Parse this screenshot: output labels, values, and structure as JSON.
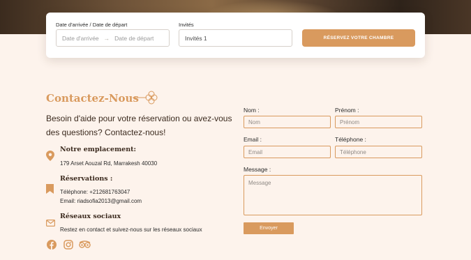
{
  "booking": {
    "dates_label": "Date d'arrivée / Date de départ",
    "arrival_placeholder": "Date d'arrivée",
    "departure_placeholder": "Date de départ",
    "guests_label": "Invités",
    "guests_value": "Invités 1",
    "reserve_button": "RÉSERVEZ VOTRE CHAMBRE"
  },
  "contact": {
    "title": "Contactez-Nous",
    "intro": "Besoin d'aide pour votre réservation ou avez-vous des questions? Contactez-nous!",
    "location": {
      "title": "Notre emplacement:",
      "address": "179 Arset Aouzal Rd, Marrakesh 40030"
    },
    "reservations": {
      "title": "Réservations :",
      "phone": "Téléphone: +212681763047",
      "email": "Email: riadsofia2013@gmail.com"
    },
    "social": {
      "title": "Réseaux sociaux",
      "text": "Restez en contact et suivez-nous sur les réseaux sociaux"
    }
  },
  "form": {
    "nom_label": "Nom :",
    "nom_placeholder": "Nom",
    "prenom_label": "Prénom :",
    "prenom_placeholder": "Prénom",
    "email_label": "Email :",
    "email_placeholder": "Email",
    "phone_label": "Téléphone :",
    "phone_placeholder": "Téléphone",
    "message_label": "Message :",
    "message_placeholder": "Message",
    "submit": "Envoyer"
  },
  "colors": {
    "accent": "#d99a5e",
    "background": "#fdf3ec",
    "text": "#3b2a1e"
  },
  "icons": [
    "map-pin-icon",
    "bookmark-icon",
    "mail-icon",
    "facebook-icon",
    "instagram-icon",
    "tripadvisor-icon",
    "ornament-icon"
  ]
}
